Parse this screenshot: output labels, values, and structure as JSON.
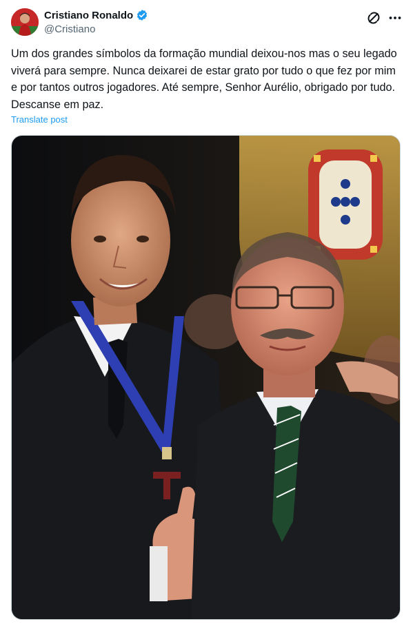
{
  "author": {
    "display_name": "Cristiano Ronaldo",
    "handle": "@Cristiano",
    "verified": true
  },
  "icons": {
    "verified": "verified-badge-icon",
    "grok": "grok-icon",
    "more": "more-options-icon"
  },
  "post": {
    "text": "Um dos grandes símbolos da formação mundial deixou-nos mas o seu legado viverá para sempre. Nunca deixarei de estar grato por tudo o que fez por mim e por tantos outros jogadores. Até sempre, Senhor Aurélio, obrigado por tudo. Descanse em paz.",
    "translate_label": "Translate post"
  },
  "colors": {
    "link": "#1d9bf0",
    "verified": "#1d9bf0",
    "secondary_text": "#536471"
  }
}
